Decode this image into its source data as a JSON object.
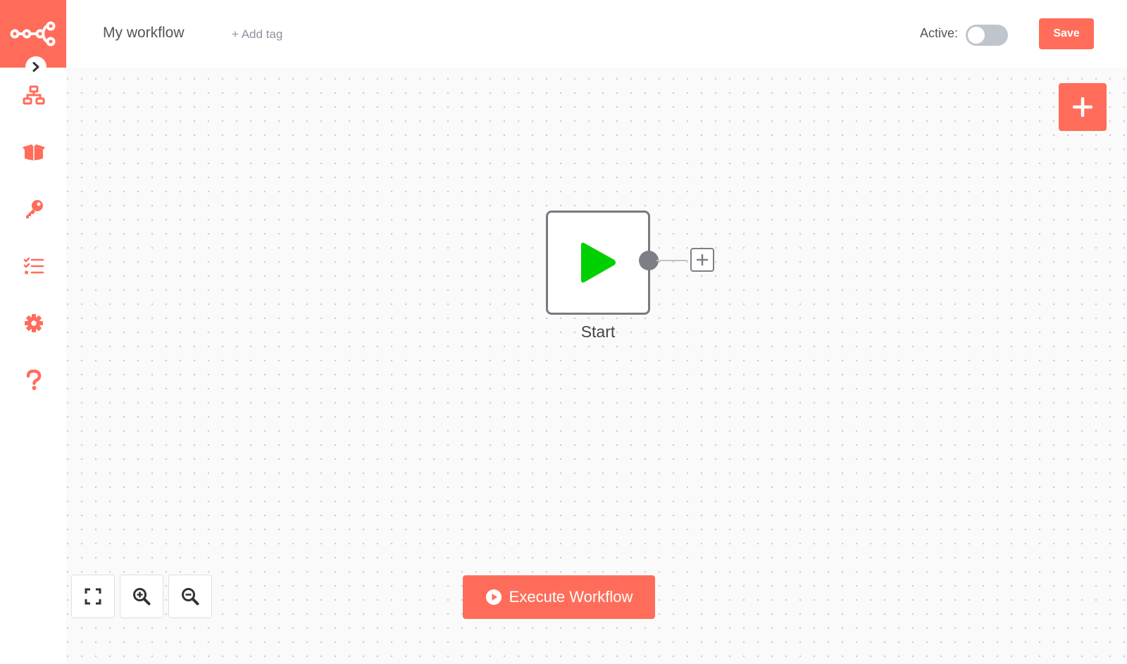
{
  "app": {
    "logo_icon": "n8n-logo-icon",
    "accent_color": "#ff6d5a"
  },
  "sidebar": {
    "expand_icon": "chevron-right-icon",
    "items": [
      {
        "id": "workflows",
        "icon": "sitemap-icon"
      },
      {
        "id": "templates",
        "icon": "box-open-icon"
      },
      {
        "id": "credentials",
        "icon": "key-icon"
      },
      {
        "id": "executions",
        "icon": "tasks-icon"
      },
      {
        "id": "settings",
        "icon": "cog-icon"
      },
      {
        "id": "help",
        "icon": "question-icon"
      }
    ]
  },
  "header": {
    "workflow_name": "My workflow",
    "add_tag_label": "+ Add tag",
    "active_label": "Active:",
    "active": false,
    "save_label": "Save"
  },
  "canvas": {
    "add_node_icon": "plus-icon",
    "nodes": [
      {
        "name": "Start",
        "icon": "play-icon",
        "icon_color": "#00d000"
      }
    ],
    "zoom_controls": [
      {
        "id": "zoom-to-fit",
        "icon": "expand-icon"
      },
      {
        "id": "zoom-in",
        "icon": "zoom-in-icon"
      },
      {
        "id": "zoom-out",
        "icon": "zoom-out-icon"
      }
    ],
    "execute_label": "Execute Workflow",
    "execute_icon": "play-circle-icon"
  }
}
